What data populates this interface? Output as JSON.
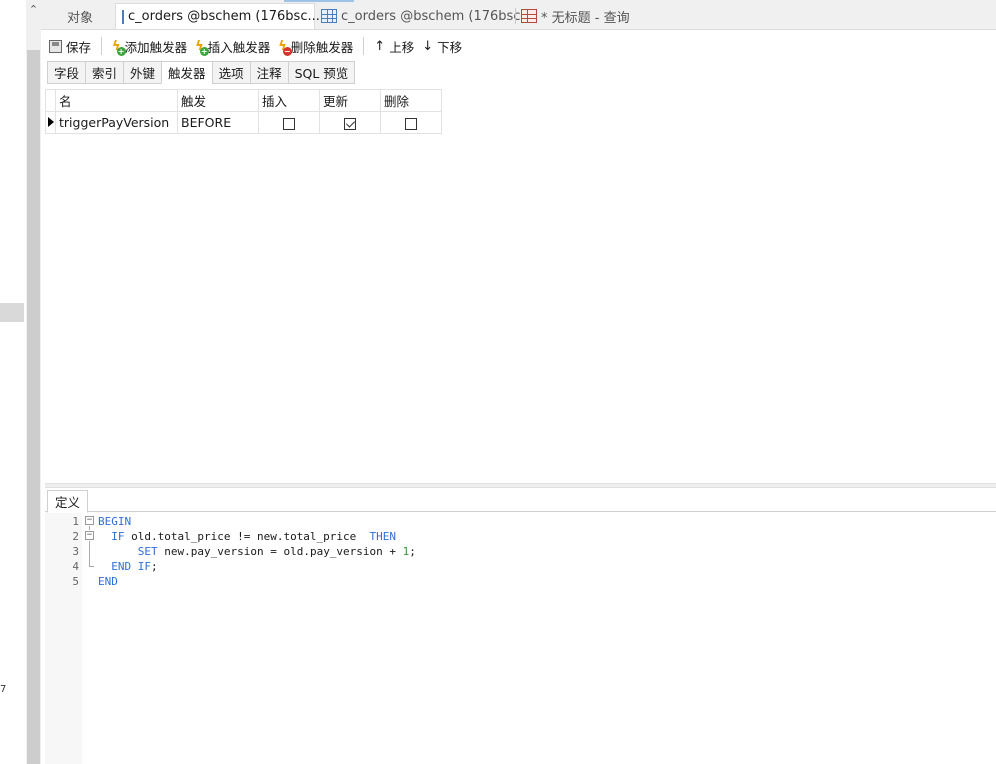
{
  "left": {
    "mark": "7"
  },
  "tabs": [
    {
      "label": "对象",
      "icon": "none",
      "active": false
    },
    {
      "label": "c_orders @bschem (176bsc...",
      "icon": "table-design-icon",
      "active": true
    },
    {
      "label": "c_orders @bschem (176bsc...",
      "icon": "table-icon",
      "active": false
    },
    {
      "label": "* 无标题 - 查询",
      "icon": "query-icon",
      "active": false
    }
  ],
  "toolbar": {
    "save": "保存",
    "add_trigger": "添加触发器",
    "insert_trigger": "插入触发器",
    "delete_trigger": "删除触发器",
    "move_up": "上移",
    "move_down": "下移"
  },
  "subtabs": [
    "字段",
    "索引",
    "外键",
    "触发器",
    "选项",
    "注释",
    "SQL 预览"
  ],
  "active_subtab": "触发器",
  "grid": {
    "columns": [
      "名",
      "触发",
      "插入",
      "更新",
      "删除"
    ],
    "rows": [
      {
        "name": "triggerPayVersion",
        "timing": "BEFORE",
        "insert": false,
        "update": true,
        "delete": false
      }
    ]
  },
  "definition": {
    "tab": "定义",
    "lines": [
      {
        "n": "1",
        "fold": "minus"
      },
      {
        "n": "2",
        "fold": "minus"
      },
      {
        "n": "3",
        "fold": ""
      },
      {
        "n": "4",
        "fold": "end"
      },
      {
        "n": "5",
        "fold": ""
      }
    ],
    "code": {
      "l1_kw": "BEGIN",
      "l2_kw1": "IF",
      "l2_mid": " old.total_price != new.total_price  ",
      "l2_kw2": "THEN",
      "l3_kw": "SET",
      "l3_mid": " new.pay_version = old.pay_version + ",
      "l3_num": "1",
      "l3_end": ";",
      "l4_kw1": "END",
      "l4_sp": " ",
      "l4_kw2": "IF",
      "l4_end": ";",
      "l5_kw": "END"
    }
  }
}
